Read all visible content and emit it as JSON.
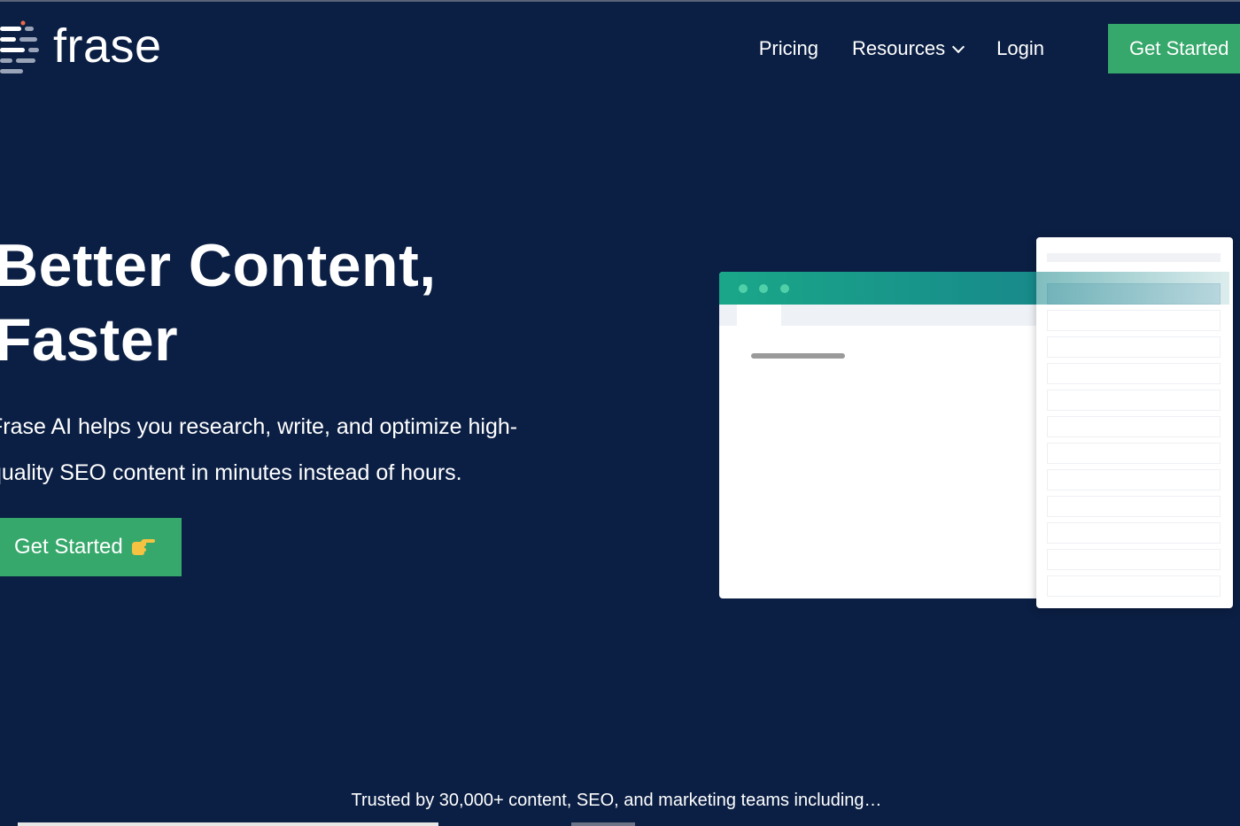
{
  "header": {
    "logo_text": "frase",
    "nav": {
      "pricing": "Pricing",
      "resources": "Resources",
      "login": "Login",
      "cta": "Get Started"
    }
  },
  "hero": {
    "title_line1": "Better Content,",
    "title_line2": "Faster",
    "subtitle_line1": "Frase AI helps you research, write, and optimize high-",
    "subtitle_line2": "quality SEO content in minutes instead of hours.",
    "cta": "Get Started"
  },
  "trusted": "Trusted by 30,000+ content, SEO, and marketing teams including…",
  "colors": {
    "background": "#0b1f44",
    "accent_green": "#36a86b",
    "mock_bar": "#1aa789"
  },
  "icons": {
    "logo": "frase-logo-icon",
    "resources_dropdown": "chevron-down-icon",
    "cta_hand": "pointing-hand-icon"
  }
}
